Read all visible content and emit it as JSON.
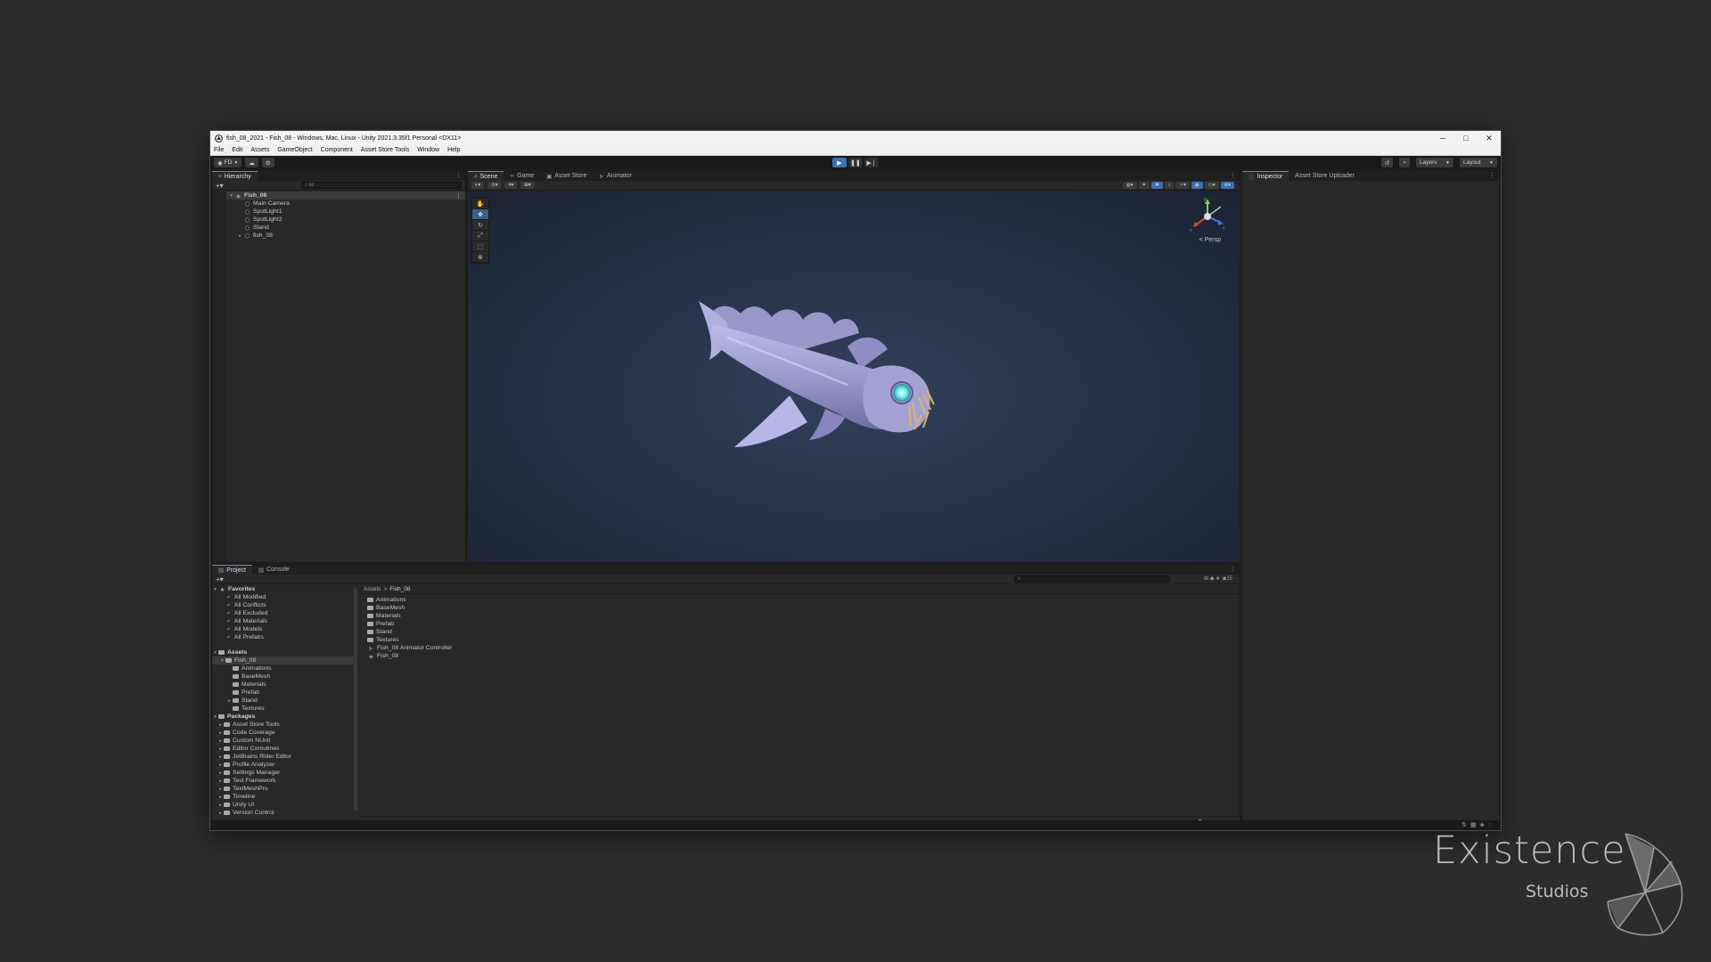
{
  "window": {
    "title": "fish_08_2021 - Fish_08 - Windows, Mac, Linux - Unity 2021.3.35f1 Personal <DX11>",
    "controls": [
      "─",
      "□",
      "✕"
    ]
  },
  "menu": [
    "File",
    "Edit",
    "Assets",
    "GameObject",
    "Component",
    "Asset Store Tools",
    "Window",
    "Help"
  ],
  "toolbar": {
    "account": "FD",
    "layers_label": "Layers",
    "layout_label": "Layout"
  },
  "hierarchy": {
    "tab_label": "Hierarchy",
    "search_placeholder": "All",
    "items": [
      {
        "label": "Fish_08",
        "depth": 0,
        "expanded": true,
        "kind": "scene"
      },
      {
        "label": "Main Camera",
        "depth": 1,
        "kind": "object"
      },
      {
        "label": "SpotLight1",
        "depth": 1,
        "kind": "object"
      },
      {
        "label": "SpotLight2",
        "depth": 1,
        "kind": "object"
      },
      {
        "label": "Stand",
        "depth": 1,
        "kind": "object"
      },
      {
        "label": "fish_08",
        "depth": 1,
        "kind": "object",
        "collapsed": true
      }
    ]
  },
  "scene_tabs": [
    {
      "label": "Scene",
      "icon": "#",
      "active": true
    },
    {
      "label": "Game",
      "icon": "∞",
      "active": false
    },
    {
      "label": "Asset Store",
      "icon": "▣",
      "active": false
    },
    {
      "label": "Animator",
      "icon": "⊱",
      "active": false
    }
  ],
  "scene": {
    "persp_label": "< Persp",
    "gizmo_labels": {
      "y": "y",
      "x": "x",
      "z": "z"
    }
  },
  "inspector": {
    "tabs": [
      {
        "label": "Inspector",
        "active": true
      },
      {
        "label": "Asset Store Uploader",
        "active": false
      }
    ]
  },
  "project": {
    "tabs": [
      {
        "label": "Project",
        "active": true
      },
      {
        "label": "Console",
        "active": false
      }
    ],
    "favorites_label": "Favorites",
    "favorites": [
      "All Modified",
      "All Conflicts",
      "All Excluded",
      "All Materials",
      "All Models",
      "All Prefabs"
    ],
    "assets_label": "Assets",
    "assets_tree": [
      {
        "label": "Fish_08",
        "depth": 1,
        "selected": true
      },
      {
        "label": "Animations",
        "depth": 2
      },
      {
        "label": "BaseMesh",
        "depth": 2
      },
      {
        "label": "Materials",
        "depth": 2
      },
      {
        "label": "Prefab",
        "depth": 2
      },
      {
        "label": "Stand",
        "depth": 2,
        "collapsed": true
      },
      {
        "label": "Textures",
        "depth": 2
      }
    ],
    "packages_label": "Packages",
    "packages": [
      "Asset Store Tools",
      "Code Coverage",
      "Custom NUnit",
      "Editor Coroutines",
      "JetBrains Rider Editor",
      "Profile Analyzer",
      "Settings Manager",
      "Test Framework",
      "TextMeshPro",
      "Timeline",
      "Unity UI",
      "Version Control"
    ],
    "breadcrumb": [
      "Assets",
      "Fish_08"
    ],
    "contents": [
      {
        "label": "Animations",
        "kind": "folder"
      },
      {
        "label": "BaseMesh",
        "kind": "folder"
      },
      {
        "label": "Materials",
        "kind": "folder"
      },
      {
        "label": "Prefab",
        "kind": "folder"
      },
      {
        "label": "Stand",
        "kind": "folder"
      },
      {
        "label": "Textures",
        "kind": "folder"
      },
      {
        "label": "Fish_08 Animator Controller",
        "kind": "animator"
      },
      {
        "label": "Fish_08",
        "kind": "scene"
      }
    ],
    "hidden_count": "15"
  },
  "watermark": {
    "title": "Existence",
    "subtitle": "Studios"
  },
  "colors": {
    "accent": "#3d6fb5",
    "panel_bg": "#282828",
    "scene_bg": "#28324a",
    "fish_body": "#a8a6d6",
    "fish_eye": "#6ff0ee"
  }
}
